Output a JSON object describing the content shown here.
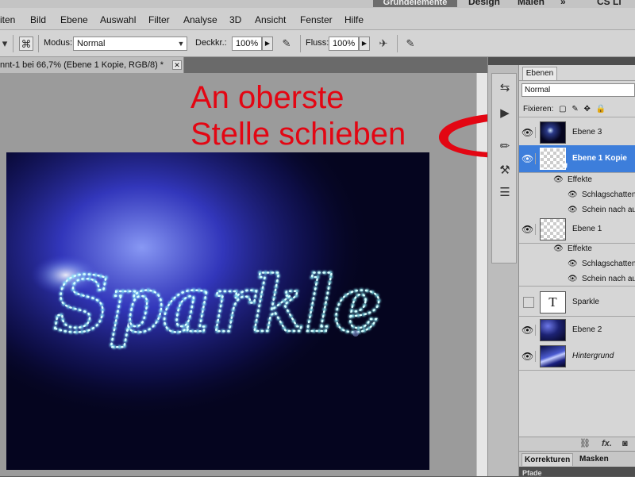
{
  "menubar": {
    "items": [
      "iten",
      "Bild",
      "Ebene",
      "Auswahl",
      "Filter",
      "Analyse",
      "3D",
      "Ansicht",
      "Fenster",
      "Hilfe"
    ],
    "workspaces": [
      "Grundelemente",
      "Design",
      "Malen"
    ],
    "more_label": "»",
    "cs_label": "CS Li"
  },
  "options": {
    "mode_label": "Modus:",
    "mode_value": "Normal",
    "opacity_label": "Deckkr.:",
    "opacity_value": "100%",
    "flow_label": "Fluss:",
    "flow_value": "100%"
  },
  "document": {
    "tab_title": "nnt-1 bei 66,7% (Ebene 1 Kopie, RGB/8) *",
    "artwork_text": "Sparkle"
  },
  "annotation": {
    "line1": "An oberste",
    "line2": "Stelle schieben"
  },
  "layers_panel": {
    "tab": "Ebenen",
    "blend_mode": "Normal",
    "lock_label": "Fixieren:",
    "layers": [
      {
        "name": "Ebene 3",
        "visible": true,
        "thumb": "sparkle-dark"
      },
      {
        "name": "Ebene 1 Kopie",
        "visible": true,
        "thumb": "transparent",
        "selected": true
      },
      {
        "effects_label": "Effekte",
        "effects": [
          "Schlagschatten",
          "Schein nach au"
        ]
      },
      {
        "name": "Ebene 1",
        "visible": true,
        "thumb": "transparent"
      },
      {
        "effects_label": "Effekte",
        "effects": [
          "Schlagschatten",
          "Schein nach au"
        ]
      },
      {
        "name": "Sparkle",
        "visible": false,
        "thumb": "text",
        "thumb_text": "T"
      },
      {
        "name": "Ebene 2",
        "visible": true,
        "thumb": "blue-gradient"
      },
      {
        "name": "Hintergrund",
        "visible": true,
        "thumb": "blue-glow",
        "italic": true
      }
    ],
    "bottom_fx": "fx.",
    "tabs_lower": [
      "Korrekturen",
      "Masken"
    ],
    "tab_bottom": "Pfade"
  },
  "colors": {
    "accent_selection": "#3d7edb",
    "annotation_red": "#e30613",
    "sparkle_cyan": "#8ff4ff"
  }
}
